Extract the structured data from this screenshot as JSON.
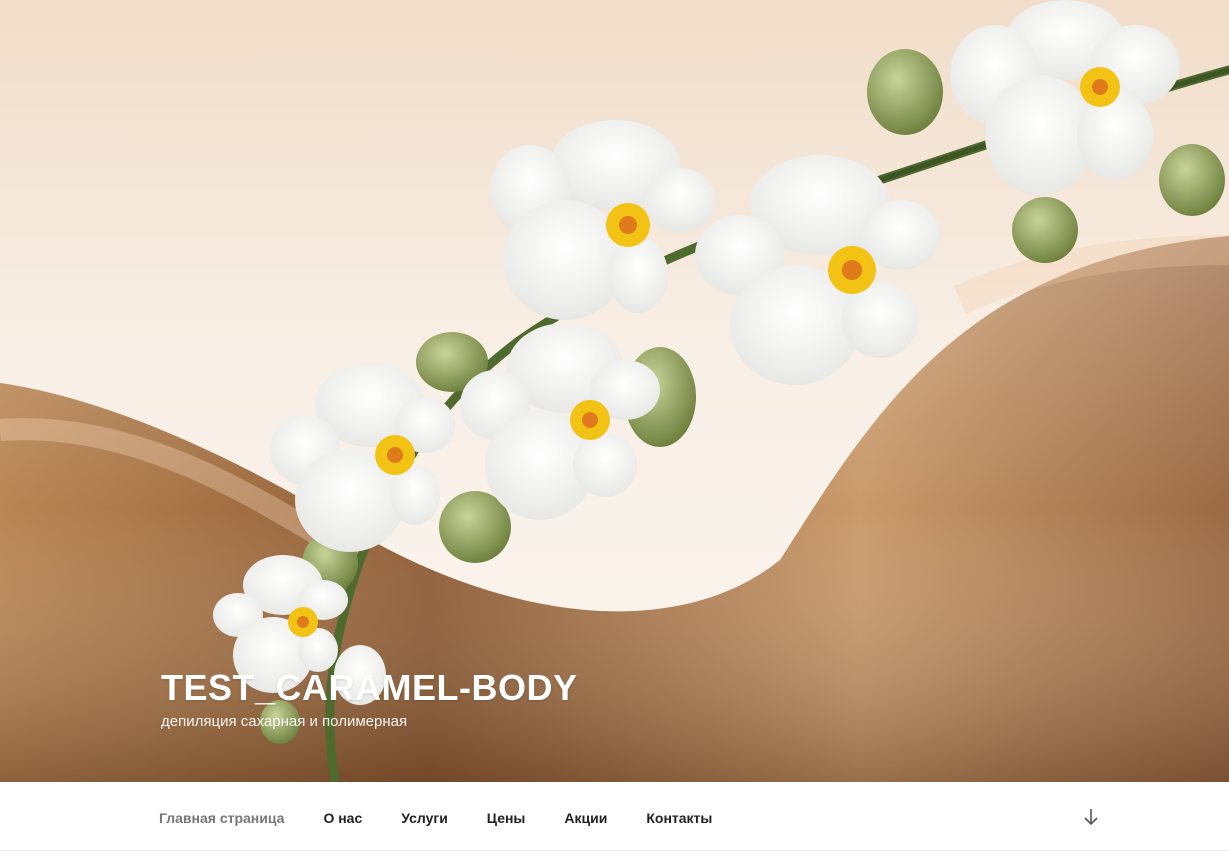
{
  "site": {
    "title": "TEST_CARAMEL-BODY",
    "description": "депиляция сахарная и полимерная"
  },
  "navigation": {
    "items": [
      {
        "label": "Главная страница",
        "current": true
      },
      {
        "label": "О нас"
      },
      {
        "label": "Услуги"
      },
      {
        "label": "Цены"
      },
      {
        "label": "Акции"
      },
      {
        "label": "Контакты"
      }
    ]
  },
  "scroll_down": {
    "icon": "arrow-down-icon"
  },
  "hero": {
    "image": "orchid-branch-over-back"
  },
  "colors": {
    "background_light": "#f7ece2",
    "skin": "#c99a6b",
    "skin_shadow": "#6e4326",
    "orchid_petal": "#ffffff",
    "orchid_center": "#f2c314",
    "stem": "#4f6a2e",
    "menu_text": "#222222",
    "menu_current": "#767676"
  }
}
